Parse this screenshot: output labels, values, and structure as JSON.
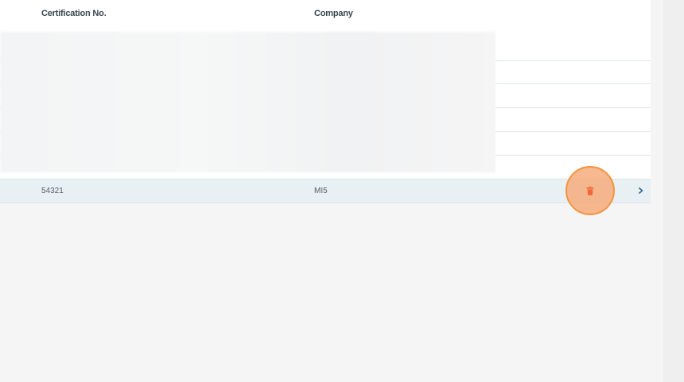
{
  "table": {
    "headers": {
      "certification_no": "Certification No.",
      "company": "Company"
    },
    "rows": [
      {
        "certification_no": "54321",
        "company": "MI5"
      }
    ],
    "row_actions": {
      "delete_icon": "trash-icon",
      "open_icon": "chevron-right-icon"
    }
  },
  "colors": {
    "accent": "#f29440",
    "highlight_fill": "#f6a878",
    "delete_icon": "#ef6a3a",
    "chevron": "#2f6f9e",
    "row_selected": "#e9f0f4"
  }
}
